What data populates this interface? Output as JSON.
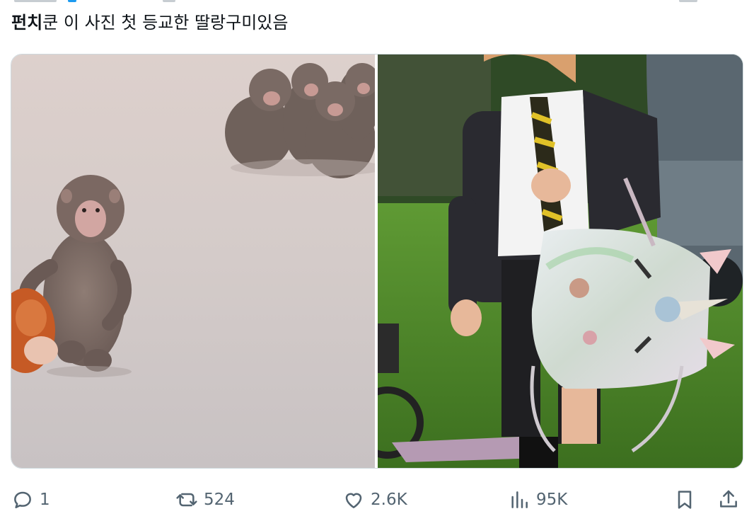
{
  "tweet": {
    "author_bold": "펀치",
    "text_rest": "쿤 이 사진 첫 등교한 딸랑구미있음"
  },
  "media": {
    "images": [
      {
        "icon": "monkey-photo"
      },
      {
        "icon": "girl-photo"
      }
    ]
  },
  "actions": {
    "reply_count": "1",
    "retweet_count": "524",
    "like_count": "2.6K",
    "views_count": "95K"
  }
}
